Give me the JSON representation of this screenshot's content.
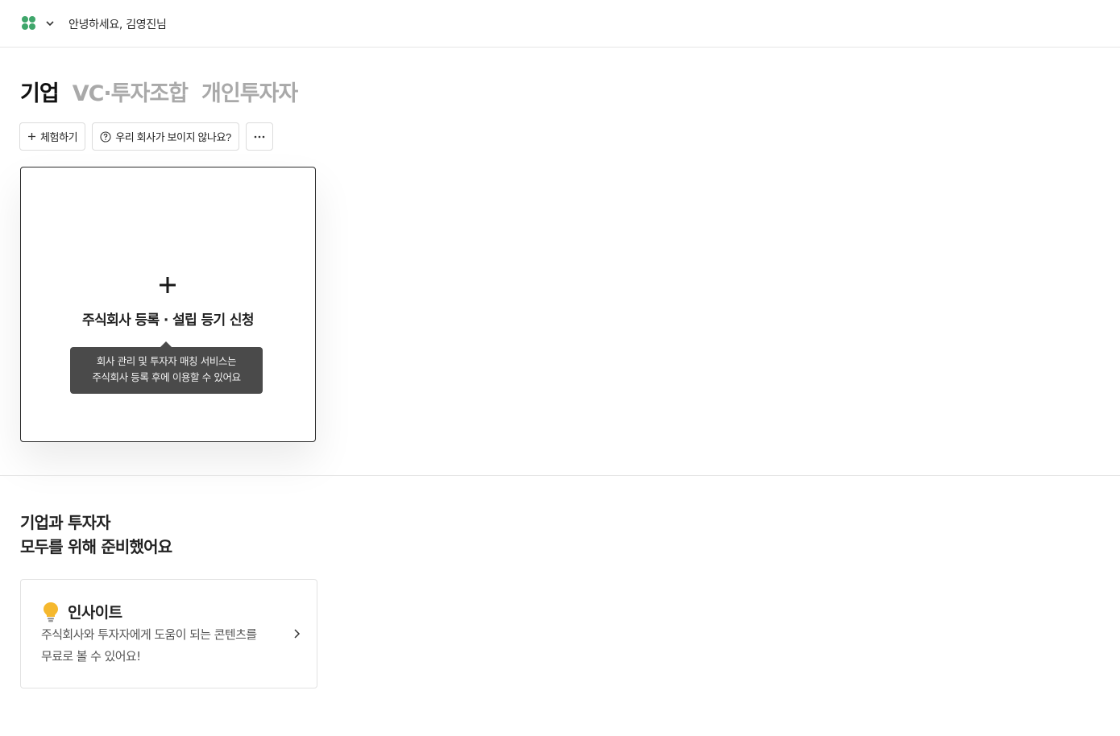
{
  "header": {
    "app_icon": "app-grid-icon",
    "menu_icon": "chevron-down-icon",
    "greeting": "안녕하세요, 김영진님",
    "brand_color": "#3fa66b"
  },
  "tabs": [
    {
      "label": "기업",
      "active": true
    },
    {
      "label": "VC·투자조합",
      "active": false
    },
    {
      "label": "개인투자자",
      "active": false
    }
  ],
  "actions": {
    "trial_label": "체험하기",
    "trial_icon": "plus-icon",
    "help_label": "우리 회사가 보이지 않나요?",
    "help_icon": "question-circle-icon",
    "more_icon": "ellipsis-icon"
  },
  "register_card": {
    "icon": "plus-icon",
    "label": "주식회사 등록 · 설립 등기 신청",
    "tooltip_line1": "회사 관리 및 투자자 매칭 서비스는",
    "tooltip_line2": "주식회사 등록 후에 이용할 수 있어요"
  },
  "section": {
    "title_line1": "기업과 투자자",
    "title_line2": "모두를 위해 준비했어요"
  },
  "insight_card": {
    "icon": "lightbulb-icon",
    "icon_color": "#f5b82e",
    "title": "인사이트",
    "desc_line1": "주식회사와 투자자에게 도움이 되는 콘텐츠를",
    "desc_line2": "무료로 볼 수 있어요!",
    "arrow_icon": "chevron-right-icon"
  }
}
